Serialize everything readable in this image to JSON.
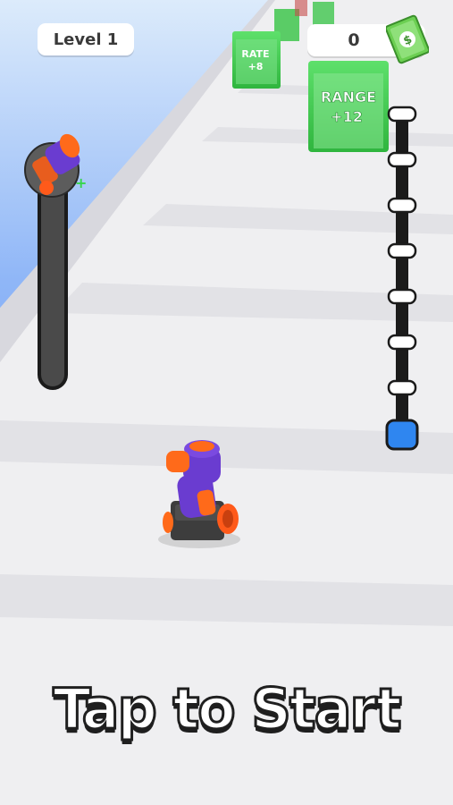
{
  "hud": {
    "level_label": "Level 1",
    "money_value": "0",
    "money_icon": "dollar-bill-icon"
  },
  "gates": [
    {
      "stat": "RATE",
      "bonus": "+8"
    },
    {
      "stat": "RANGE",
      "bonus": "+12"
    }
  ],
  "power_meter": {
    "level": 0,
    "icon": "cannon-icon"
  },
  "progress_track": {
    "checkpoints": 7,
    "current": 0
  },
  "prompt": {
    "text": "Tap to Start"
  },
  "colors": {
    "sky": "#5d8cf6",
    "road": "#eeeeee",
    "gate": "#3fc64d",
    "cannon_barrel": "#6a3cd0",
    "cannon_accent": "#ff6a1a",
    "cannon_base": "#3d3d3d",
    "track_dot": "#2f86f0"
  }
}
